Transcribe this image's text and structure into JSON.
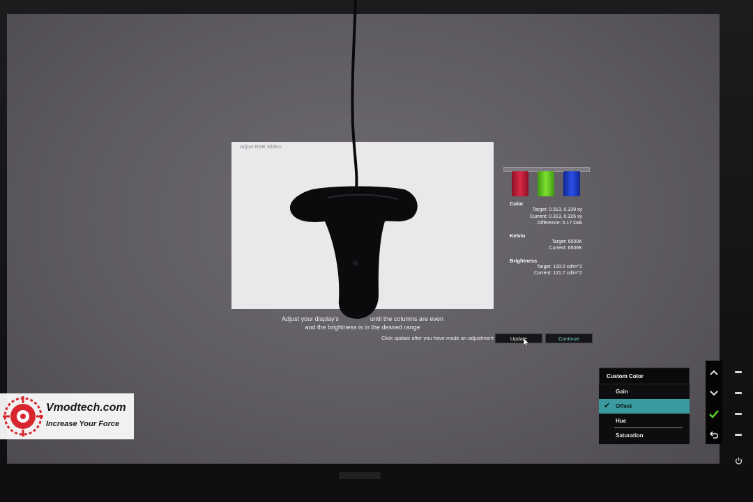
{
  "calibration": {
    "window_title": "Adjust RGB Sliders",
    "instruction_line1": "Adjust your display's ",
    "instruction_line1_end": "until the columns are even",
    "instruction_line2": "and the brightness is in the desired range",
    "update_hint": "Click update after you have made an adjustment",
    "update_label": "Update",
    "continue_label": "Continue",
    "columns": [
      {
        "name": "red",
        "color": "#cc1f3a"
      },
      {
        "name": "green",
        "color": "#6fd42a"
      },
      {
        "name": "blue",
        "color": "#1f3fd6"
      }
    ],
    "color": {
      "heading": "Color",
      "target": "Target: 0.313, 0.329 xy",
      "current": "Current: 0.313, 0.326 xy",
      "difference": "Difference: 0.17 Dab"
    },
    "kelvin": {
      "heading": "Kelvin",
      "target": "Target: 6500K",
      "current": "Current: 6506K"
    },
    "brightness": {
      "heading": "Brightness",
      "target": "Target: 120.0 cd/m^2",
      "current": "Current: 121.7 cd/m^2"
    }
  },
  "osd": {
    "title": "Custom Color",
    "items": [
      {
        "label": "Gain",
        "selected": false
      },
      {
        "label": "Offset",
        "selected": true
      },
      {
        "label": "Hue",
        "selected": false
      },
      {
        "label": "Saturation",
        "selected": false
      }
    ],
    "keys": [
      "up-icon",
      "down-icon",
      "check-icon",
      "back-icon"
    ]
  },
  "watermark": {
    "title": "Vmodtech.com",
    "subtitle": "Increase Your Force"
  },
  "colors": {
    "osd_highlight": "#3a9aa0",
    "check_green": "#5ed12a"
  }
}
